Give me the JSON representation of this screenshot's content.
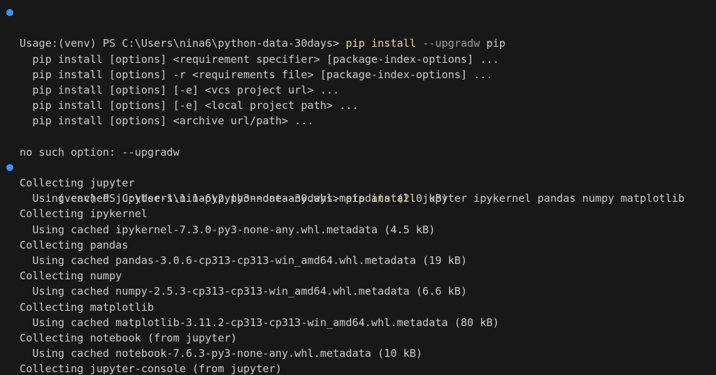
{
  "theme": {
    "background": "#181818",
    "foreground": "#cccccc",
    "command_color": "#dcdcaa",
    "flag_color": "#9d9d9d",
    "decoration_dot_color": "#3794ff"
  },
  "terminal": {
    "prompt1": {
      "prompt": "(venv) PS C:\\Users\\nina6\\python-data-30days> ",
      "cmd": "pip install",
      "flag": " --upgradw",
      "arg": " pip",
      "decoration": "success-dot-icon"
    },
    "usage_lines": [
      "Usage:",
      "  pip install [options] <requirement specifier> [package-index-options] ...",
      "  pip install [options] -r <requirements file> [package-index-options] ...",
      "  pip install [options] [-e] <vcs project url> ...",
      "  pip install [options] [-e] <local project path> ...",
      "  pip install [options] <archive url/path> ..."
    ],
    "error_line": "no such option: --upgradw",
    "prompt2": {
      "prompt": "(venv) PS C:\\Users\\nina6\\python-data-30days> ",
      "cmd": "pip install",
      "args": " jupyter ipykernel pandas numpy matplotlib",
      "decoration": "success-dot-icon"
    },
    "output_lines": [
      "Collecting jupyter",
      "  Using cached jupyter-1.1.1-py2.py3-none-any.whl.metadata (2.0 kB)",
      "Collecting ipykernel",
      "  Using cached ipykernel-7.3.0-py3-none-any.whl.metadata (4.5 kB)",
      "Collecting pandas",
      "  Using cached pandas-3.0.6-cp313-cp313-win_amd64.whl.metadata (19 kB)",
      "Collecting numpy",
      "  Using cached numpy-2.5.3-cp313-cp313-win_amd64.whl.metadata (6.6 kB)",
      "Collecting matplotlib",
      "  Using cached matplotlib-3.11.2-cp313-cp313-win_amd64.whl.metadata (80 kB)",
      "Collecting notebook (from jupyter)",
      "  Using cached notebook-7.6.3-py3-none-any.whl.metadata (10 kB)",
      "Collecting jupyter-console (from jupyter)"
    ]
  }
}
